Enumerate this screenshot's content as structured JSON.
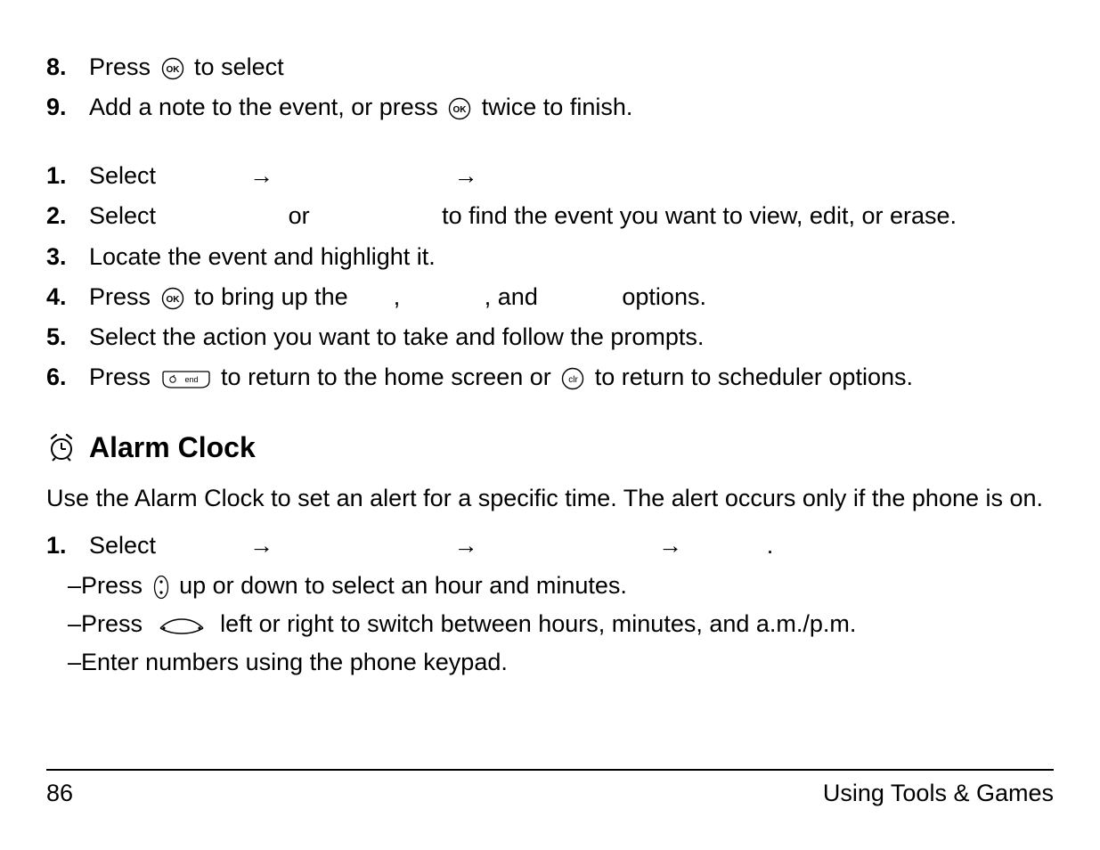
{
  "listA": {
    "items": [
      {
        "num": "8.",
        "p1": "Press ",
        "p2": " to select"
      },
      {
        "num": "9.",
        "p1": "Add a note to the event, or press ",
        "p2": " twice to finish."
      }
    ]
  },
  "listB": {
    "items": [
      {
        "num": "1.",
        "p1": "Select",
        "arrow": "→"
      },
      {
        "num": "2.",
        "p1": "Select",
        "p2": "or",
        "p3": "to find the event you want to view, edit, or erase."
      },
      {
        "num": "3.",
        "p1": "Locate the event and highlight it."
      },
      {
        "num": "4.",
        "p1": "Press ",
        "p2": " to bring up the",
        "comma": ",",
        "p3": ", and",
        "p4": "options."
      },
      {
        "num": "5.",
        "p1": "Select the action you want to take and follow the prompts."
      },
      {
        "num": "6.",
        "p1": "Press ",
        "p2": " to return to the home screen or ",
        "p3": " to return to scheduler options."
      }
    ]
  },
  "alarm": {
    "heading": "Alarm Clock",
    "intro": "Use the Alarm Clock to set an alert for a specific time. The alert occurs only if the phone is on.",
    "step1_num": "1.",
    "step1_p1": "Select",
    "arrow": "→",
    "dot": ".",
    "sub": [
      {
        "dash": "–",
        "p1": "Press ",
        "p2": " up or down to select an hour and minutes."
      },
      {
        "dash": "–",
        "p1": "Press ",
        "p2": " left or right to switch between hours, minutes, and a.m./p.m."
      },
      {
        "dash": "–",
        "p1": "Enter numbers using the phone keypad."
      }
    ]
  },
  "footer": {
    "page": "86",
    "section": "Using Tools & Games"
  }
}
